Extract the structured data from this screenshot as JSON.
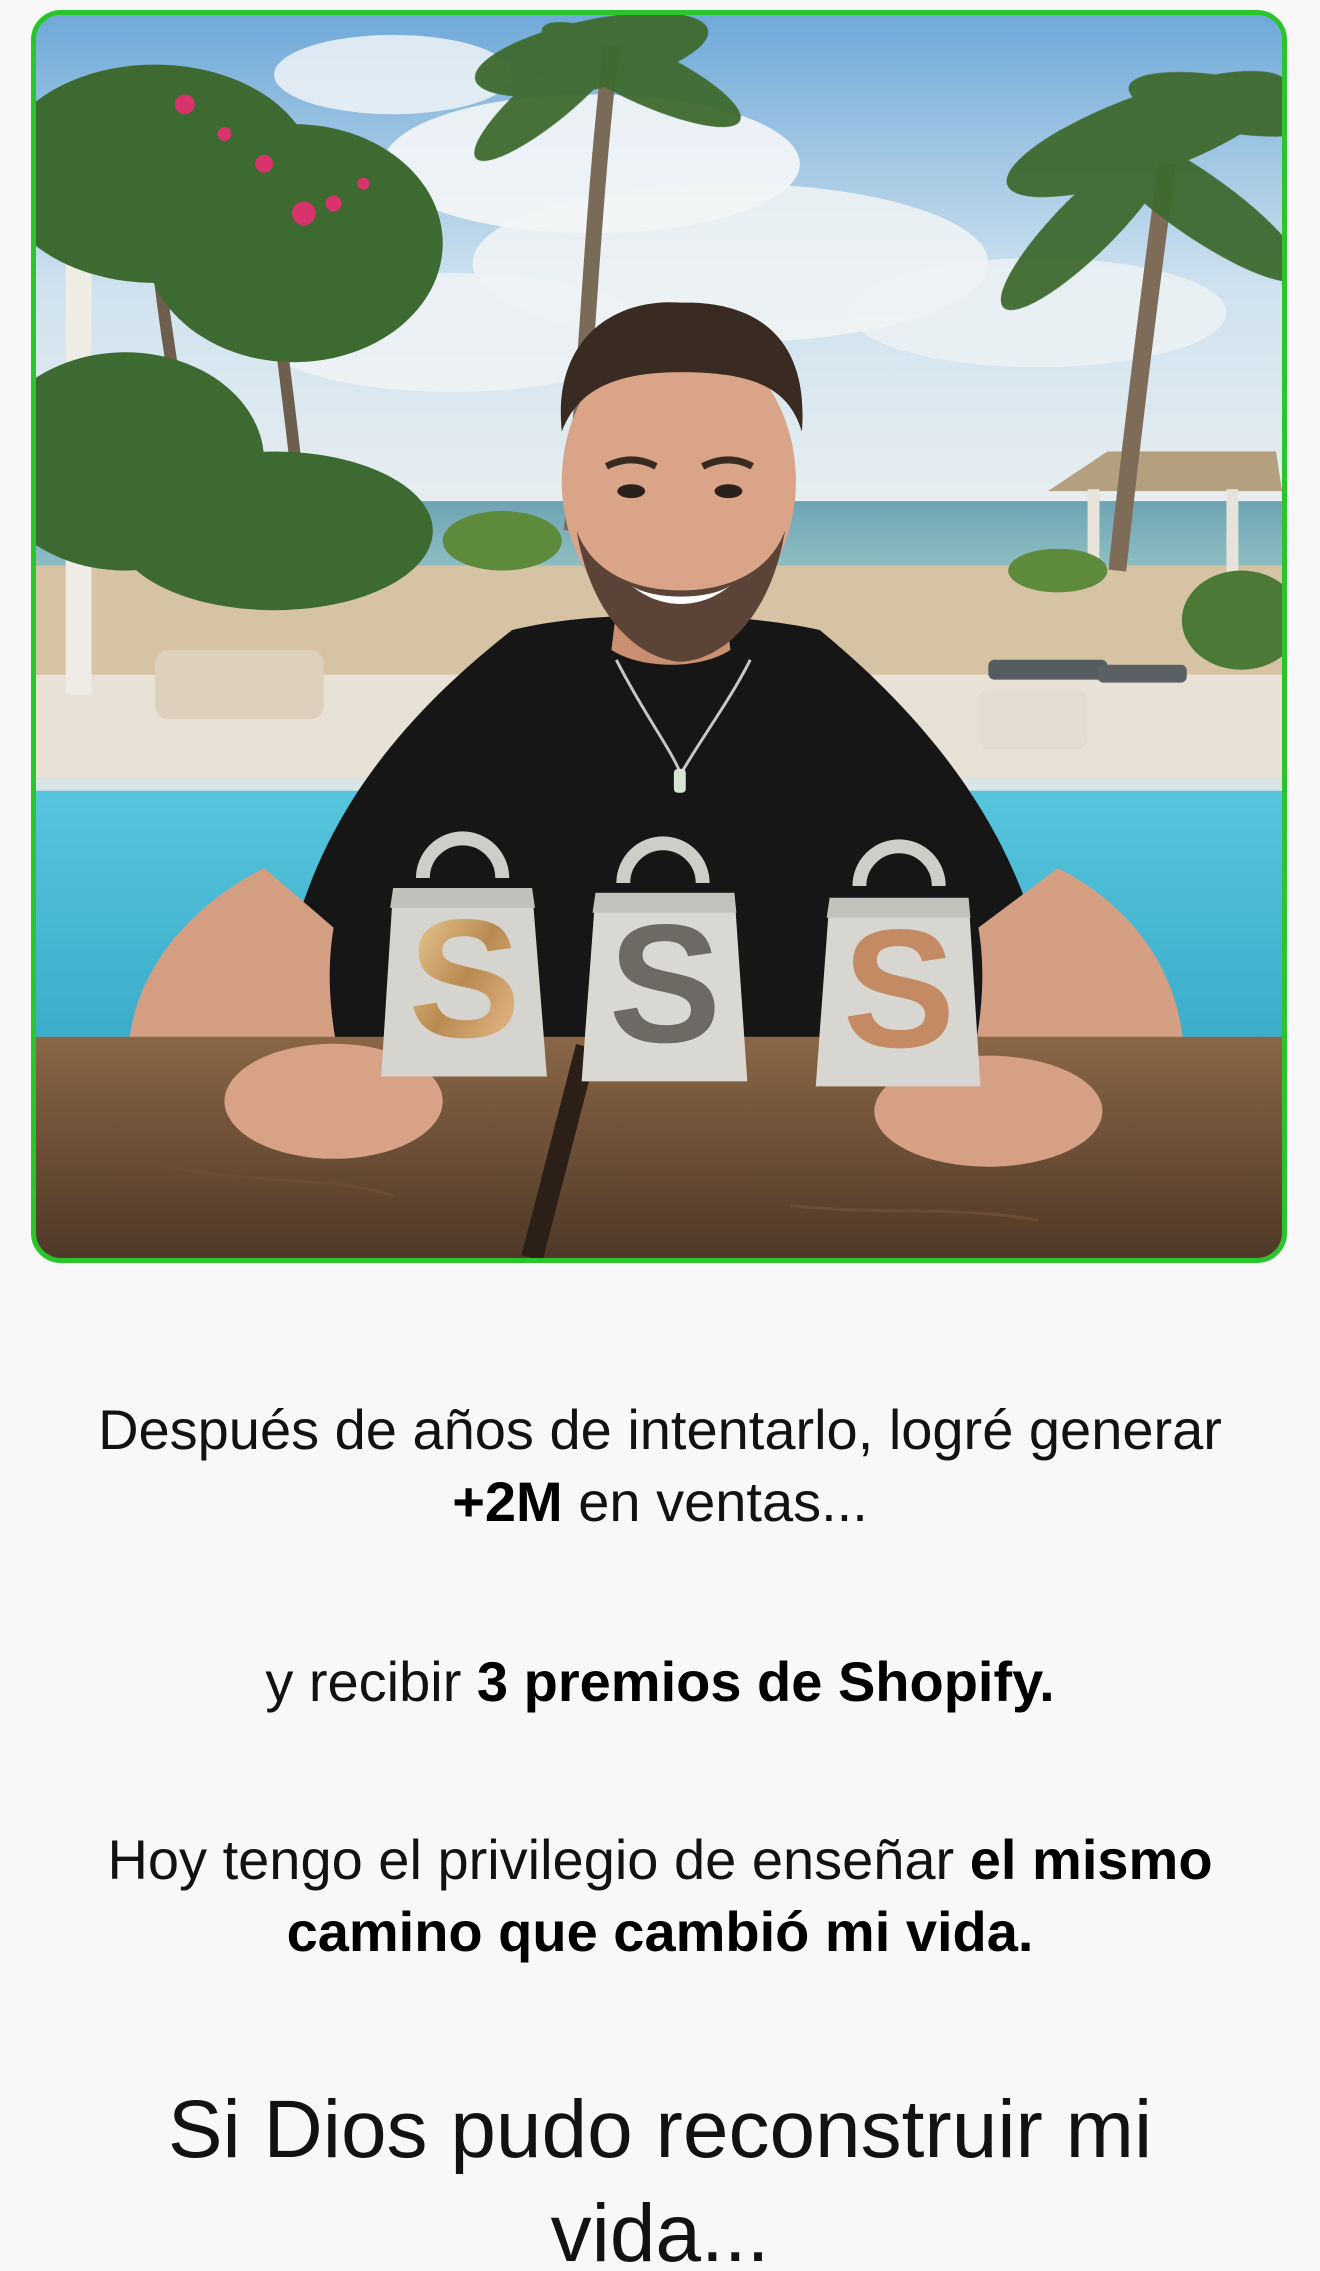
{
  "photo": {
    "alt": "Hombre sonriendo junto a tres premios de Shopify frente a una piscina y la playa",
    "award_glyph": "S",
    "border_color": "#2ac52a"
  },
  "paragraphs": {
    "p1": {
      "before": "Después de años de intentarlo, logré generar ",
      "bold": "+2M",
      "after": " en ventas..."
    },
    "p2": {
      "before": "y recibir ",
      "bold": "3 premios de Shopify."
    },
    "p3": {
      "before": "Hoy tengo el privilegio de enseñar ",
      "bold": "el mismo camino que cambió mi vida."
    }
  },
  "heading": {
    "text": "Si Dios pudo reconstruir mi vida..."
  }
}
